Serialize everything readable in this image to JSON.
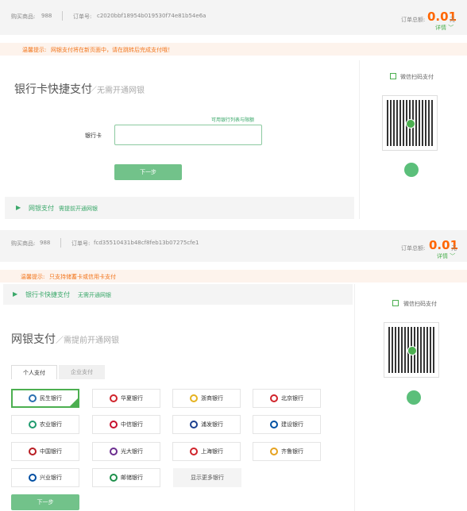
{
  "top": {
    "product_label": "购买商品:",
    "product_value": "988",
    "order_label": "订单号:",
    "order_value": "c2020bbf18954b019530f74e81b54e6a",
    "total_label": "订单总额:",
    "price": "0.01",
    "unit": "元",
    "detail": "详情 ﹀",
    "warn_label": "温馨提示:",
    "warn_text": "网银支付将在新页面中，请在跳转后完成支付哦！",
    "title": "银行卡快捷支付",
    "subtitle": "／无需开通网银",
    "supported_link": "可用银行列表与限额",
    "card_label": "银行卡",
    "card_placeholder": "",
    "next": "下一步",
    "alt_pay": "网银支付",
    "alt_sub": "需提前开通网银",
    "wechat_label": "微信扫码支付"
  },
  "bottom": {
    "product_label": "购买商品:",
    "product_value": "988",
    "order_label": "订单号:",
    "order_value": "fcd35510431b48cf8feb13b07275cfe1",
    "total_label": "订单总额:",
    "price": "0.01",
    "unit": "元",
    "detail": "详情 ﹀",
    "warn_label": "温馨提示:",
    "warn_text": "只支持储蓄卡或信用卡支付",
    "alt_pay": "银行卡快捷支付",
    "alt_sub": "无需开通网银",
    "title": "网银支付",
    "subtitle": "／需提前开通网银",
    "tab_personal": "个人支付",
    "tab_business": "企业支付",
    "banks": [
      {
        "name": "民生银行",
        "color": "#2a6fb0"
      },
      {
        "name": "华夏银行",
        "color": "#d0232a"
      },
      {
        "name": "浙商银行",
        "color": "#e6b21f"
      },
      {
        "name": "北京银行",
        "color": "#d0232a"
      },
      {
        "name": "农业银行",
        "color": "#1f9b6e"
      },
      {
        "name": "中信银行",
        "color": "#c8102e"
      },
      {
        "name": "浦发银行",
        "color": "#1b3f8f"
      },
      {
        "name": "建设银行",
        "color": "#0051a3"
      },
      {
        "name": "中国银行",
        "color": "#b81c22"
      },
      {
        "name": "光大银行",
        "color": "#6b2d8f"
      },
      {
        "name": "上海银行",
        "color": "#d0232a"
      },
      {
        "name": "齐鲁银行",
        "color": "#e6a21f"
      },
      {
        "name": "兴业银行",
        "color": "#004ea2"
      },
      {
        "name": "邮储银行",
        "color": "#1d8f4a"
      }
    ],
    "more_banks": "显示更多银行",
    "next": "下一步",
    "wechat_label": "微信扫码支付"
  }
}
